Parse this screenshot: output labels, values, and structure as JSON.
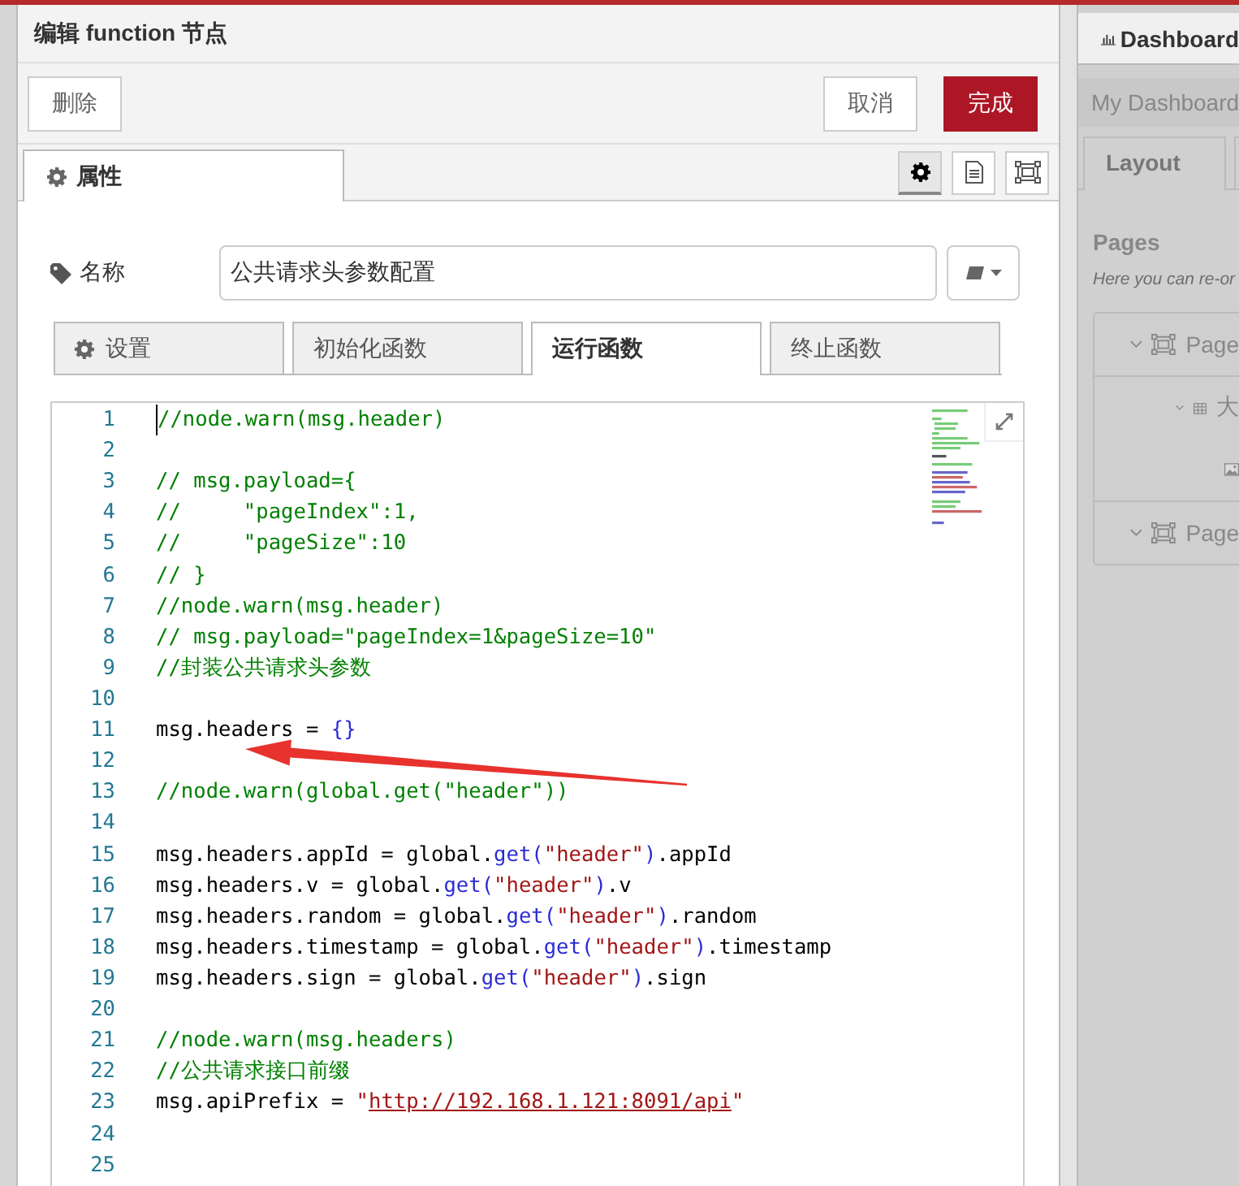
{
  "dialog": {
    "title": "编辑 function 节点",
    "buttons": [
      {
        "label": "删除",
        "kind": "plain"
      },
      {
        "label": "取消",
        "kind": "plain"
      },
      {
        "label": "完成",
        "kind": "primary"
      }
    ],
    "tabs": [
      {
        "label": "属性",
        "selected": true
      }
    ],
    "tool_icons": [
      {
        "selected": true
      },
      {
        "selected": false
      },
      {
        "selected": false
      }
    ],
    "name_field": {
      "label": "名称",
      "value": "公共请求头参数配置"
    },
    "code_tabs": [
      {
        "label": "设置",
        "selected": false
      },
      {
        "label": "初始化函数",
        "selected": false
      },
      {
        "label": "运行函数",
        "selected": true
      },
      {
        "label": "终止函数",
        "selected": false
      }
    ],
    "code_lines": [
      {
        "number": "1",
        "tokens": [
          {
            "kind": "comment",
            "text": "//node.warn(msg.header)"
          }
        ]
      },
      {
        "number": "2"
      },
      {
        "number": "3",
        "tokens": [
          {
            "kind": "comment",
            "text": "// msg.payload={"
          }
        ]
      },
      {
        "number": "4",
        "tokens": [
          {
            "kind": "comment",
            "text": "//     \"pageIndex\":1,"
          }
        ]
      },
      {
        "number": "5",
        "tokens": [
          {
            "kind": "comment",
            "text": "//     \"pageSize\":10"
          }
        ]
      },
      {
        "number": "6",
        "tokens": [
          {
            "kind": "comment",
            "text": "// }"
          }
        ]
      },
      {
        "number": "7",
        "tokens": [
          {
            "kind": "comment",
            "text": "//node.warn(msg.header)"
          }
        ]
      },
      {
        "number": "8",
        "tokens": [
          {
            "kind": "comment",
            "text": "// msg.payload=\"pageIndex=1&pageSize=10\""
          }
        ]
      },
      {
        "number": "9",
        "tokens": [
          {
            "kind": "comment",
            "text": "//封装公共请求头参数"
          }
        ]
      },
      {
        "number": "10"
      },
      {
        "number": "11",
        "tokens": [
          {
            "kind": "plain",
            "text": "msg.headers = "
          },
          {
            "kind": "bracket",
            "text": "{}"
          }
        ]
      },
      {
        "number": "12"
      },
      {
        "number": "13",
        "tokens": [
          {
            "kind": "comment",
            "text": "//node.warn(global.get(\"header\"))"
          }
        ]
      },
      {
        "number": "14"
      },
      {
        "number": "15",
        "tokens": [
          {
            "kind": "plain",
            "text": "msg.headers.appId = global."
          },
          {
            "kind": "func",
            "text": "get"
          },
          {
            "kind": "bracket",
            "text": "("
          },
          {
            "kind": "string",
            "text": "\"header\""
          },
          {
            "kind": "bracket",
            "text": ")"
          },
          {
            "kind": "plain",
            "text": ".appId"
          }
        ]
      },
      {
        "number": "16",
        "tokens": [
          {
            "kind": "plain",
            "text": "msg.headers.v = global."
          },
          {
            "kind": "func",
            "text": "get"
          },
          {
            "kind": "bracket",
            "text": "("
          },
          {
            "kind": "string",
            "text": "\"header\""
          },
          {
            "kind": "bracket",
            "text": ")"
          },
          {
            "kind": "plain",
            "text": ".v"
          }
        ]
      },
      {
        "number": "17",
        "tokens": [
          {
            "kind": "plain",
            "text": "msg.headers.random = global."
          },
          {
            "kind": "func",
            "text": "get"
          },
          {
            "kind": "bracket",
            "text": "("
          },
          {
            "kind": "string",
            "text": "\"header\""
          },
          {
            "kind": "bracket",
            "text": ")"
          },
          {
            "kind": "plain",
            "text": ".random"
          }
        ]
      },
      {
        "number": "18",
        "tokens": [
          {
            "kind": "plain",
            "text": "msg.headers.timestamp = global."
          },
          {
            "kind": "func",
            "text": "get"
          },
          {
            "kind": "bracket",
            "text": "("
          },
          {
            "kind": "string",
            "text": "\"header\""
          },
          {
            "kind": "bracket",
            "text": ")"
          },
          {
            "kind": "plain",
            "text": ".timestamp"
          }
        ]
      },
      {
        "number": "19",
        "tokens": [
          {
            "kind": "plain",
            "text": "msg.headers.sign = global."
          },
          {
            "kind": "func",
            "text": "get"
          },
          {
            "kind": "bracket",
            "text": "("
          },
          {
            "kind": "string",
            "text": "\"header\""
          },
          {
            "kind": "bracket",
            "text": ")"
          },
          {
            "kind": "plain",
            "text": ".sign"
          }
        ]
      },
      {
        "number": "20"
      },
      {
        "number": "21",
        "tokens": [
          {
            "kind": "comment",
            "text": "//node.warn(msg.headers)"
          }
        ]
      },
      {
        "number": "22",
        "tokens": [
          {
            "kind": "comment",
            "text": "//公共请求接口前缀"
          }
        ]
      },
      {
        "number": "23",
        "tokens": [
          {
            "kind": "plain",
            "text": "msg.apiPrefix = "
          },
          {
            "kind": "string",
            "text": "\""
          },
          {
            "kind": "link",
            "text": "http://192.168.1.121:8091/api"
          },
          {
            "kind": "string",
            "text": "\""
          }
        ]
      },
      {
        "number": "24"
      },
      {
        "number": "25"
      }
    ],
    "annotation": {
      "kind": "arrow"
    }
  },
  "side_panel": {
    "tab": "Dashboard",
    "title": "My Dashboard",
    "tabs": [
      {
        "label": "Layout",
        "selected": true
      },
      {
        "selected": false
      }
    ],
    "section": "Pages",
    "hint": "Here you can re-or",
    "tree": [
      {
        "label": "Page",
        "kind": "page",
        "expanded": true,
        "children": [
          {
            "label": "大",
            "kind": "group",
            "expanded": true,
            "children": [
              {
                "kind": "image"
              }
            ]
          }
        ]
      },
      {
        "label": "Page",
        "kind": "page",
        "expanded": true
      }
    ]
  }
}
